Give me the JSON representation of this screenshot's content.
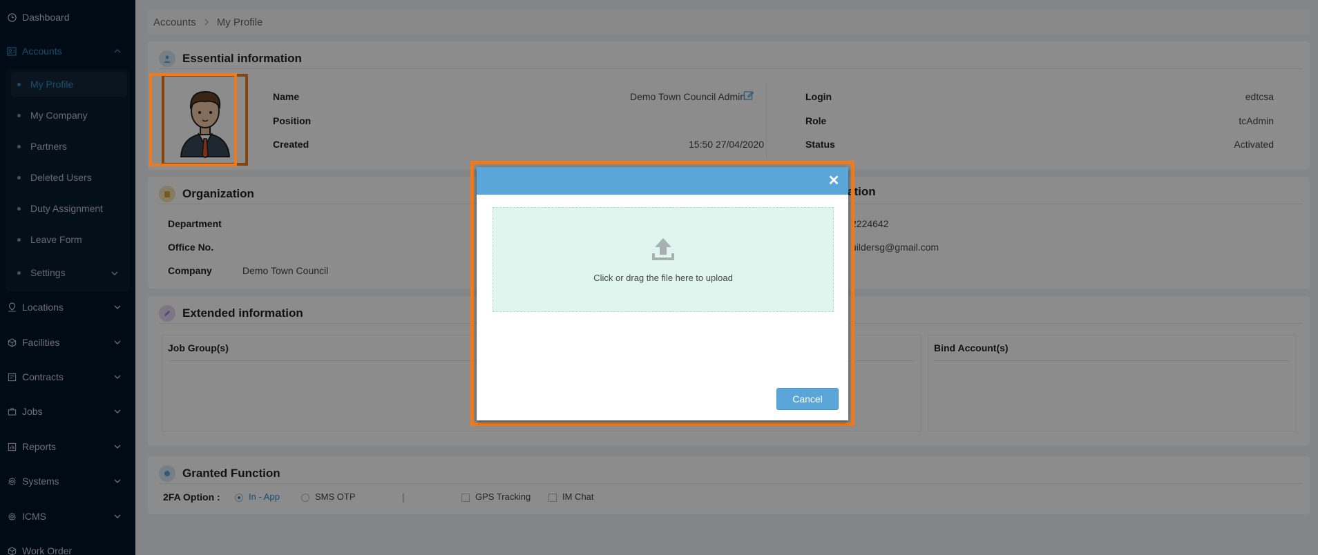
{
  "sidebar": {
    "items": [
      {
        "label": "Dashboard",
        "icon": "clock-icon"
      },
      {
        "label": "Accounts",
        "icon": "accounts-icon"
      },
      {
        "label": "Locations",
        "icon": "location-pin-icon"
      },
      {
        "label": "Facilities",
        "icon": "cube-icon"
      },
      {
        "label": "Contracts",
        "icon": "contract-icon"
      },
      {
        "label": "Jobs",
        "icon": "briefcase-icon"
      },
      {
        "label": "Reports",
        "icon": "bar-chart-icon"
      },
      {
        "label": "Systems",
        "icon": "gear-icon"
      },
      {
        "label": "ICMS",
        "icon": "gear-icon"
      },
      {
        "label": "Work Order",
        "icon": "cube-icon"
      }
    ],
    "accounts_sub": [
      {
        "label": "My Profile"
      },
      {
        "label": "My Company"
      },
      {
        "label": "Partners"
      },
      {
        "label": "Deleted Users"
      },
      {
        "label": "Duty Assignment"
      },
      {
        "label": "Leave Form"
      },
      {
        "label": "Settings"
      }
    ]
  },
  "breadcrumb": {
    "root": "Accounts",
    "current": "My Profile"
  },
  "essential": {
    "title": "Essential information",
    "name_label": "Name",
    "name_value": "Demo Town Council Admin",
    "position_label": "Position",
    "position_value": "",
    "created_label": "Created",
    "created_value": "15:50 27/04/2020",
    "login_label": "Login",
    "login_value": "edtcsa",
    "role_label": "Role",
    "role_value": "tcAdmin",
    "status_label": "Status",
    "status_value": "Activated"
  },
  "organization": {
    "title": "Organization",
    "department_label": "Department",
    "office_label": "Office No.",
    "company_label": "Company",
    "company_value": "Demo Town Council",
    "right_title_fragment": "ation",
    "phone_fragment": "2224642",
    "email_fragment": "uildersg@gmail.com"
  },
  "extended": {
    "title": "Extended information",
    "job_group_label": "Job Group(s)",
    "bind_account_label": "Bind Account(s)"
  },
  "granted": {
    "title": "Granted Function",
    "twofa_label": "2FA Option :",
    "inapp_label": "In - App",
    "sms_label": "SMS OTP",
    "divider": "|",
    "gps_label": "GPS Tracking",
    "im_label": "IM Chat"
  },
  "modal": {
    "close_glyph": "✕",
    "dropzone_text": "Click or drag the file here to upload",
    "cancel_label": "Cancel"
  },
  "colors": {
    "accent": "#5aa6d9",
    "highlight": "#f27a1a",
    "sidebar": "#001529",
    "link": "#2d8fd0"
  }
}
